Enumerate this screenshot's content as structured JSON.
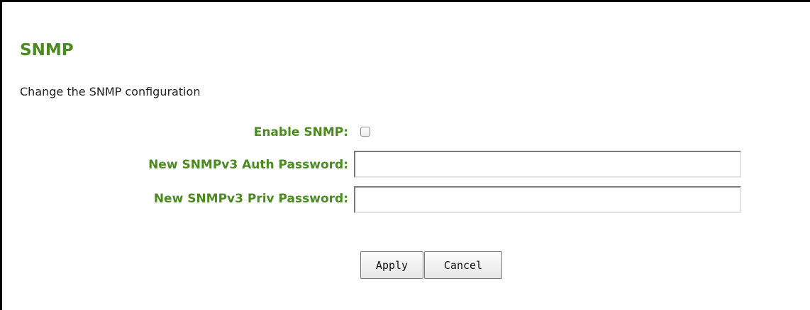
{
  "page": {
    "title": "SNMP",
    "description": "Change the SNMP configuration"
  },
  "form": {
    "enable_snmp": {
      "label": "Enable SNMP:",
      "checked": false
    },
    "auth_password": {
      "label": "New SNMPv3 Auth Password:",
      "value": ""
    },
    "priv_password": {
      "label": "New SNMPv3 Priv Password:",
      "value": ""
    }
  },
  "actions": {
    "apply_label": "Apply",
    "cancel_label": "Cancel"
  },
  "colors": {
    "accent_green": "#4a8a1e",
    "frame_border": "#000000"
  }
}
